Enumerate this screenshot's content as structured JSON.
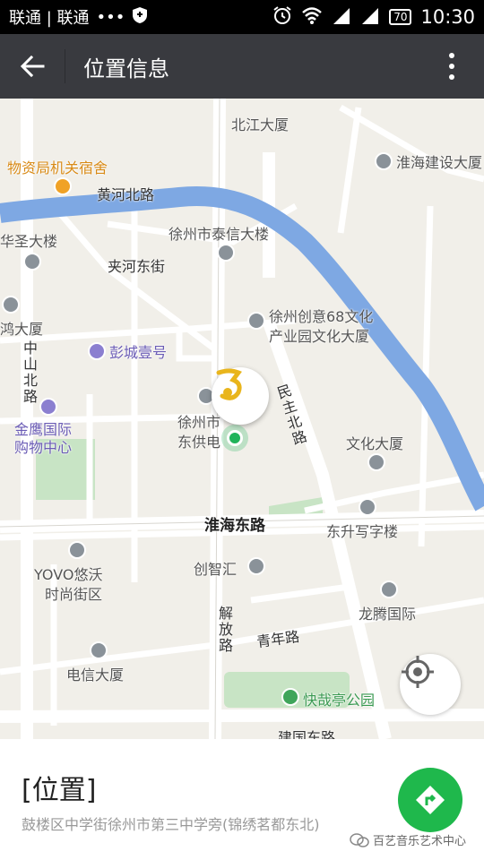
{
  "status_bar": {
    "carrier": "联通 | 联通",
    "dots": "•••",
    "battery": "70",
    "time": "10:30"
  },
  "app_bar": {
    "title": "位置信息"
  },
  "map": {
    "labels": {
      "beijiang": "北江大厦",
      "wuziju": "物资局机关宿舍",
      "huaihai_jianshe": "淮海建设大厦",
      "huanghe_road": "黄河北路",
      "huasheng": "华圣大楼",
      "taixin": "徐州市泰信大楼",
      "jiahe_street": "夹河东街",
      "chuangyi1": "徐州创意68文化",
      "chuangyi2": "产业园文化大厦",
      "hong": "鸿大厦",
      "pengcheng": "彭城壹号",
      "zhongshan": "中山北路",
      "minzhu": "民主北路",
      "jinying1": "金鹰国际",
      "jinying2": "购物中心",
      "xuzhou_gongdian1": "徐州市",
      "xuzhou_gongdian2": "东供电",
      "wenhua": "文化大厦",
      "huaihai_east": "淮海东路",
      "dongsheng": "东升写字楼",
      "yovo1": "YOVO悠沃",
      "yovo2": "时尚街区",
      "chuangzhi": "创智汇",
      "jiefang": "解放路",
      "longteng": "龙腾国际",
      "qingnian": "青年路",
      "dianxin": "电信大厦",
      "kuaizai": "快哉亭公园",
      "jianguo": "建国东路"
    }
  },
  "location": {
    "title": "[位置]",
    "address": "鼓楼区中学街徐州市第三中学旁(锦绣茗都东北)"
  },
  "watermark": "百艺音乐艺术中心",
  "colors": {
    "accent": "#1fb84c",
    "river": "#7ea8e3",
    "app_bar": "#393a3f"
  }
}
